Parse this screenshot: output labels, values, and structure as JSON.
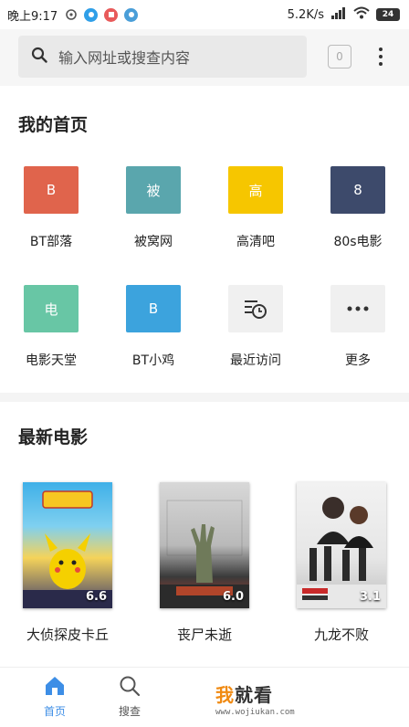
{
  "status_bar": {
    "time": "晚上9:17",
    "network_speed": "5.2K/s",
    "battery": "24"
  },
  "search": {
    "placeholder": "输入网址或搜查内容",
    "tab_count": "0"
  },
  "home": {
    "title": "我的首页",
    "tiles": [
      {
        "label": "BT部落",
        "letter": "B",
        "color": "#e0644c"
      },
      {
        "label": "被窝网",
        "letter": "被",
        "color": "#5aa6ad"
      },
      {
        "label": "高清吧",
        "letter": "高",
        "color": "#f6c600"
      },
      {
        "label": "80s电影",
        "letter": "8",
        "color": "#3d4a6b"
      },
      {
        "label": "电影天堂",
        "letter": "电",
        "color": "#68c6a5"
      },
      {
        "label": "BT小鸡",
        "letter": "B",
        "color": "#3ca3dd"
      },
      {
        "label": "最近访问",
        "icon": "history-icon"
      },
      {
        "label": "更多",
        "icon": "more-dots-icon"
      }
    ]
  },
  "movies": {
    "title": "最新电影",
    "items": [
      {
        "title": "大侦探皮卡丘",
        "rating": "6.6"
      },
      {
        "title": "丧尸未逝",
        "rating": "6.0"
      },
      {
        "title": "九龙不败",
        "rating": "3.1"
      }
    ]
  },
  "bottom_nav": {
    "home_label": "首页",
    "search_label": "搜查",
    "watermark_text": "我就看",
    "watermark_url": "www.wojiukan.com"
  },
  "colors": {
    "nav_active": "#3d8ee6",
    "watermark_accent": "#f08a12"
  }
}
